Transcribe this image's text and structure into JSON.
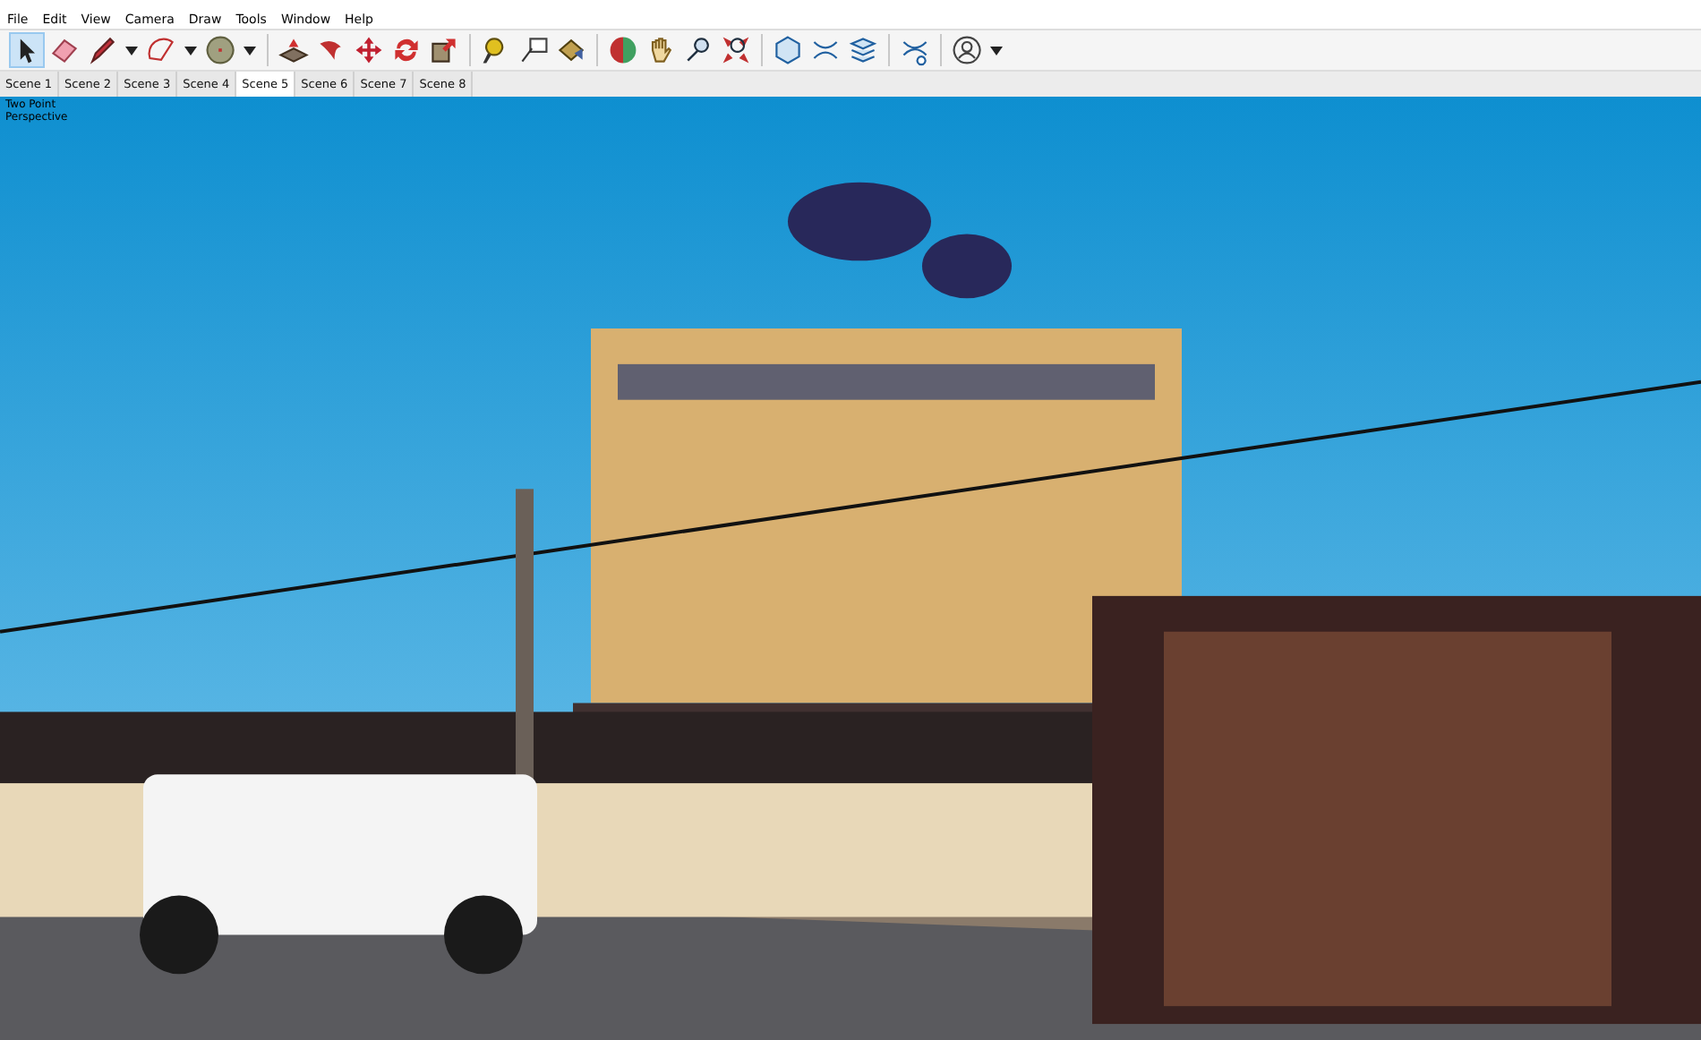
{
  "menu": [
    "File",
    "Edit",
    "View",
    "Camera",
    "Draw",
    "Tools",
    "Window",
    "Help"
  ],
  "toolbar": [
    {
      "kind": "select",
      "selected": true,
      "dropdown": false,
      "group_end": false
    },
    {
      "kind": "eraser",
      "selected": false,
      "dropdown": false,
      "group_end": false
    },
    {
      "kind": "pencil",
      "selected": false,
      "dropdown": true,
      "group_end": false
    },
    {
      "kind": "arc",
      "selected": false,
      "dropdown": true,
      "group_end": false
    },
    {
      "kind": "disc",
      "selected": false,
      "dropdown": true,
      "group_end": true
    },
    {
      "kind": "pushpull",
      "selected": false,
      "dropdown": false,
      "group_end": false
    },
    {
      "kind": "followme",
      "selected": false,
      "dropdown": false,
      "group_end": false
    },
    {
      "kind": "move",
      "selected": false,
      "dropdown": false,
      "group_end": false
    },
    {
      "kind": "rotate",
      "selected": false,
      "dropdown": false,
      "group_end": false
    },
    {
      "kind": "scale",
      "selected": false,
      "dropdown": false,
      "group_end": true
    },
    {
      "kind": "tape",
      "selected": false,
      "dropdown": false,
      "group_end": false
    },
    {
      "kind": "text",
      "selected": false,
      "dropdown": false,
      "group_end": false
    },
    {
      "kind": "bucket",
      "selected": false,
      "dropdown": false,
      "group_end": true
    },
    {
      "kind": "orbit",
      "selected": false,
      "dropdown": false,
      "group_end": false
    },
    {
      "kind": "pan",
      "selected": false,
      "dropdown": false,
      "group_end": false
    },
    {
      "kind": "zoom",
      "selected": false,
      "dropdown": false,
      "group_end": false
    },
    {
      "kind": "extents",
      "selected": false,
      "dropdown": false,
      "group_end": true
    },
    {
      "kind": "warehouse",
      "selected": false,
      "dropdown": false,
      "group_end": false
    },
    {
      "kind": "extension",
      "selected": false,
      "dropdown": false,
      "group_end": false
    },
    {
      "kind": "layers",
      "selected": false,
      "dropdown": false,
      "group_end": true
    },
    {
      "kind": "manager",
      "selected": false,
      "dropdown": false,
      "group_end": true
    },
    {
      "kind": "user",
      "selected": false,
      "dropdown": true,
      "group_end": false
    }
  ],
  "scenes": [
    {
      "label": "Scene 1",
      "selected": false
    },
    {
      "label": "Scene 2",
      "selected": false
    },
    {
      "label": "Scene 3",
      "selected": false
    },
    {
      "label": "Scene 4",
      "selected": false
    },
    {
      "label": "Scene 5",
      "selected": true
    },
    {
      "label": "Scene 6",
      "selected": false
    },
    {
      "label": "Scene 7",
      "selected": false
    },
    {
      "label": "Scene 8",
      "selected": false
    }
  ],
  "viewport": {
    "camera_label": "Two Point Perspective",
    "kind": "picture"
  }
}
